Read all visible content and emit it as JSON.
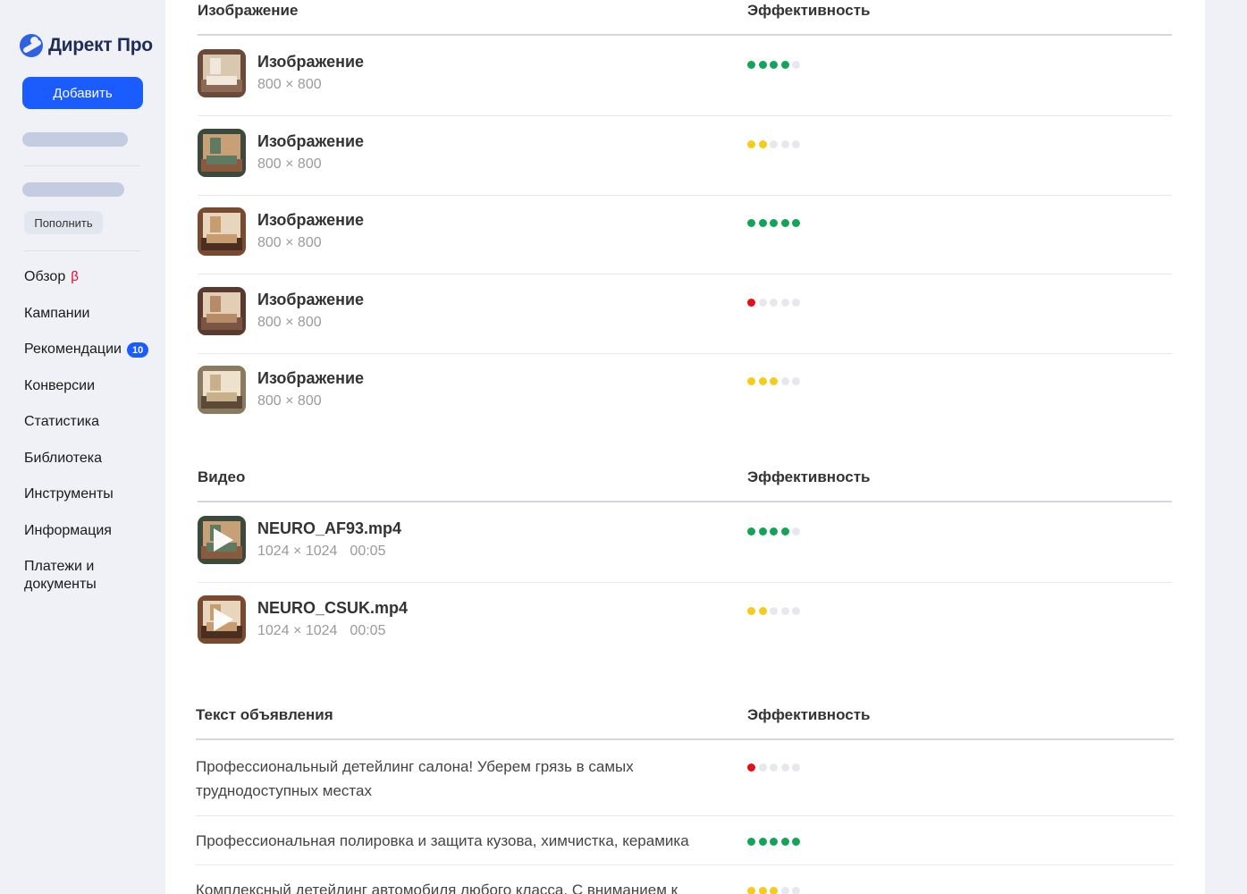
{
  "app": {
    "logo_text": "Директ Про"
  },
  "sidebar": {
    "add_label": "Добавить",
    "topup_label": "Пополнить",
    "nav": [
      {
        "label": "Обзор",
        "beta": "β"
      },
      {
        "label": "Кампании"
      },
      {
        "label": "Рекомендации",
        "badge": "10"
      },
      {
        "label": "Конверсии"
      },
      {
        "label": "Статистика"
      },
      {
        "label": "Библиотека"
      },
      {
        "label": "Инструменты"
      },
      {
        "label": "Информация"
      },
      {
        "label": "Платежи и документы"
      }
    ]
  },
  "images": {
    "header": "Изображение",
    "eff_header": "Эффективность",
    "items": [
      {
        "title": "Изображение",
        "size": "800 × 800",
        "rating": 4,
        "color": "green"
      },
      {
        "title": "Изображение",
        "size": "800 × 800",
        "rating": 2,
        "color": "yellow"
      },
      {
        "title": "Изображение",
        "size": "800 × 800",
        "rating": 5,
        "color": "green"
      },
      {
        "title": "Изображение",
        "size": "800 × 800",
        "rating": 1,
        "color": "red"
      },
      {
        "title": "Изображение",
        "size": "800 × 800",
        "rating": 3,
        "color": "yellow"
      }
    ]
  },
  "videos": {
    "header": "Видео",
    "eff_header": "Эффективность",
    "items": [
      {
        "title": "NEURO_AF93.mp4",
        "size": "1024 × 1024",
        "duration": "00:05",
        "rating": 4,
        "color": "green"
      },
      {
        "title": "NEURO_CSUK.mp4",
        "size": "1024 × 1024",
        "duration": "00:05",
        "rating": 2,
        "color": "yellow"
      }
    ]
  },
  "texts": {
    "header": "Текст объявления",
    "eff_header": "Эффективность",
    "items": [
      {
        "text": "Профессиональный детейлинг салона! Уберем грязь в самых труднодоступных местах",
        "rating": 1,
        "color": "red"
      },
      {
        "text": "Профессиональная полировка и защита кузова, химчистка, керамика",
        "rating": 5,
        "color": "green"
      },
      {
        "text": "Комплексный детейлинг автомобиля любого класса. С вниманием к",
        "rating": 3,
        "color": "yellow"
      }
    ]
  },
  "colors": {
    "accent": "#1a5cff",
    "green": "#15a35a",
    "yellow": "#f5cb1c",
    "red": "#e0111b",
    "empty": "#e6e8ed"
  }
}
